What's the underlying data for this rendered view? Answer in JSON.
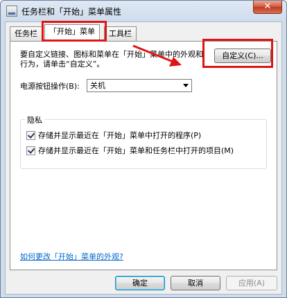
{
  "window": {
    "title": "任务栏和「开始」菜单属性",
    "close_glyph": "✕"
  },
  "tabs": [
    {
      "label": "任务栏"
    },
    {
      "label": "「开始」菜单"
    },
    {
      "label": "工具栏"
    }
  ],
  "start_menu": {
    "description": "要自定义链接、图标和菜单在「开始」菜单中的外观和行为，请单击“自定义”。",
    "customize_button": "自定义(C)...",
    "power_label": "电源按钮操作(B):",
    "power_value": "关机",
    "privacy": {
      "title": "隐私",
      "items": [
        {
          "label": "存储并显示最近在「开始」菜单中打开的程序(P)",
          "checked": true
        },
        {
          "label": "存储并显示最近在「开始」菜单和任务栏中打开的项目(M)",
          "checked": true
        }
      ]
    },
    "help_link": "如何更改「开始」菜单的外观?"
  },
  "footer": {
    "ok": "确定",
    "cancel": "取消",
    "apply": "应用(A)"
  },
  "annotation_color": "#e01414"
}
